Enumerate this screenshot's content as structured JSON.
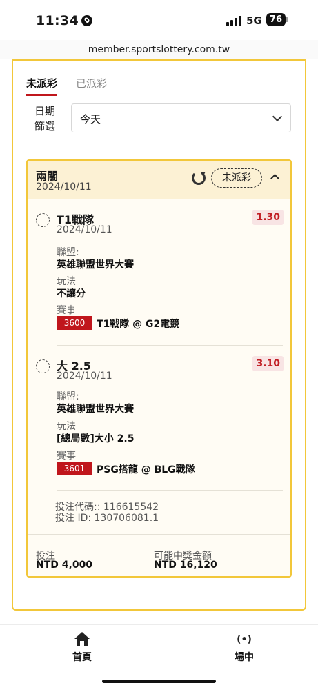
{
  "status_bar": {
    "time": "11:34",
    "network": "5G",
    "battery": "76"
  },
  "browser": {
    "url": "member.sportslottery.com.tw"
  },
  "tabs": [
    {
      "label": "未派彩",
      "active": true
    },
    {
      "label": "已派彩",
      "active": false
    }
  ],
  "filter": {
    "label": "日期\n篩選",
    "selected": "今天"
  },
  "bet": {
    "type": "兩關",
    "date": "2024/10/11",
    "status": "未派彩",
    "selections": [
      {
        "title": "T1戰隊",
        "date": "2024/10/11",
        "odds": "1.30",
        "league_label": "聯盟:",
        "league": "英雄聯盟世界大賽",
        "market_label": "玩法",
        "market": "不讓分",
        "event_label": "賽事",
        "match_code": "3600",
        "match": "T1戰隊 @ G2電競"
      },
      {
        "title": "大 2.5",
        "date": "2024/10/11",
        "odds": "3.10",
        "league_label": "聯盟:",
        "league": "英雄聯盟世界大賽",
        "market_label": "玩法",
        "market": "[總局數]大小 2.5",
        "event_label": "賽事",
        "match_code": "3601",
        "match": "PSG搭龍 @ BLG戰隊"
      }
    ],
    "bet_code": "投注代碼:: 116615542",
    "bet_id": "投注 ID: 130706081.1",
    "stake_label": "投注",
    "stake": "NTD 4,000",
    "payout_label": "可能中獎金額",
    "payout": "NTD 16,120"
  },
  "bottom_nav": [
    {
      "label": "首頁",
      "icon": "home-icon"
    },
    {
      "label": "場中",
      "icon": "live-signal-icon"
    }
  ],
  "colors": {
    "accent_yellow": "#f2c73a",
    "brand_red": "#c0161c",
    "header_bg": "#fcf1d4"
  }
}
